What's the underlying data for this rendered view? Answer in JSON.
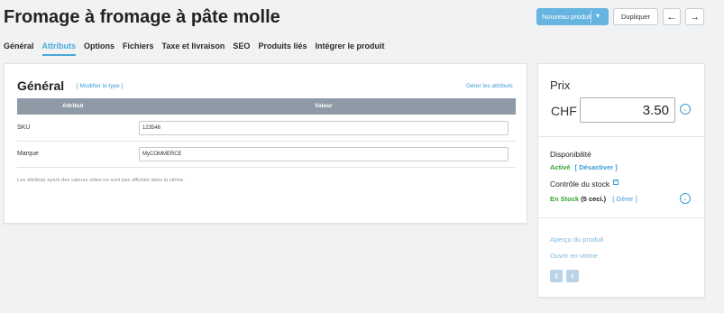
{
  "page": {
    "title": "Fromage à fromage à pâte molle"
  },
  "toolbar": {
    "new_product_label": "Nouveau produit",
    "duplicate_label": "Dupliquer",
    "prev_icon": "arrow-left-icon",
    "next_icon": "arrow-right-icon"
  },
  "tabs": [
    {
      "label": "Général",
      "active": false
    },
    {
      "label": "Attributs",
      "active": true
    },
    {
      "label": "Options",
      "active": false
    },
    {
      "label": "Fichiers",
      "active": false
    },
    {
      "label": "Taxe et livraison",
      "active": false
    },
    {
      "label": "SEO",
      "active": false
    },
    {
      "label": "Produits liés",
      "active": false
    },
    {
      "label": "Intégrer le produit",
      "active": false
    }
  ],
  "attributes": {
    "heading": "Général",
    "modify_type_link": "[ Modifier le type ]",
    "manage_link": "Gérer les attributs",
    "columns": [
      "Attribut",
      "Valeur"
    ],
    "rows": [
      {
        "label": "SKU",
        "value": "123546"
      },
      {
        "label": "Marque",
        "value": "MyCOMMERCE"
      }
    ],
    "note": "Les attributs ayant des valeurs vides ne sont pas affichés dans la vitrine."
  },
  "sidebar": {
    "price_label": "Prix",
    "currency": "CHF",
    "price_value": "3.50",
    "availability_label": "Disponibilité",
    "availability_status": "Activé",
    "deactivate_link": "[ Désactiver ]",
    "stock_control_label": "Contrôle du stock",
    "stock_status": "En Stock",
    "stock_count": "(5 ceci.)",
    "manage_stock_link": "[ Gérer ]",
    "preview_link": "Aperçu du produit",
    "open_store_link": "Ouvrir en vitrine",
    "social": [
      {
        "name": "facebook-icon",
        "glyph": "f"
      },
      {
        "name": "twitter-icon",
        "glyph": "t"
      }
    ]
  },
  "colors": {
    "accent": "#4aa8d8",
    "link": "#3a9bd5",
    "primary_button": "#65b5e0",
    "table_header": "#8e9aa6",
    "status_green": "#3aa33a"
  }
}
